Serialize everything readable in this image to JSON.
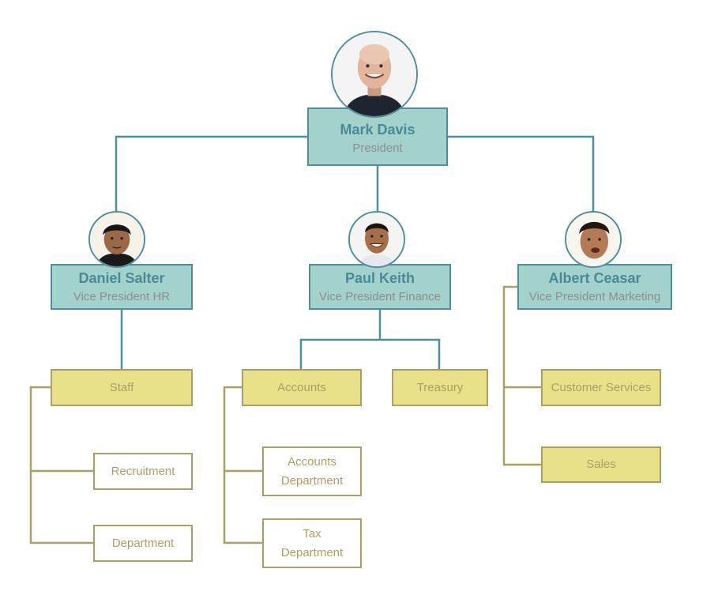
{
  "colors": {
    "exec_fill": "#a3d1cb",
    "exec_border": "#4f8f9d",
    "exec_name": "#4a8a98",
    "exec_title": "#8e8e8e",
    "dept_fill": "#e9e08a",
    "dept_border": "#a9a066",
    "dept_text": "#a9a066",
    "sub_fill": "#ffffff"
  },
  "president": {
    "name": "Mark Davis",
    "title": "President",
    "photo": "bald-man-portrait"
  },
  "vice_presidents": [
    {
      "name": "Daniel Salter",
      "title": "Vice President HR",
      "photo": "man-portrait",
      "departments": [
        {
          "label": "Staff",
          "subunits": [
            "Recruitment",
            "Department"
          ]
        }
      ]
    },
    {
      "name": "Paul Keith",
      "title": "Vice President Finance",
      "photo": "smiling-man-portrait",
      "departments": [
        {
          "label": "Accounts",
          "subunits": [
            "Accounts Department",
            "Tax Department"
          ]
        },
        {
          "label": "Treasury",
          "subunits": []
        }
      ]
    },
    {
      "name": "Albert Ceasar",
      "title": "Vice President Marketing",
      "photo": "man-portrait",
      "departments": [
        {
          "label": "Customer Services",
          "subunits": []
        },
        {
          "label": "Sales",
          "subunits": []
        }
      ]
    }
  ],
  "labels": {
    "staff": "Staff",
    "recruitment": "Recruitment",
    "hr_department": "Department",
    "accounts": "Accounts",
    "accounts_dept_line1": "Accounts",
    "accounts_dept_line2": "Department",
    "tax_dept_line1": "Tax",
    "tax_dept_line2": "Department",
    "treasury": "Treasury",
    "customer_services": "Customer Services",
    "sales": "Sales"
  }
}
